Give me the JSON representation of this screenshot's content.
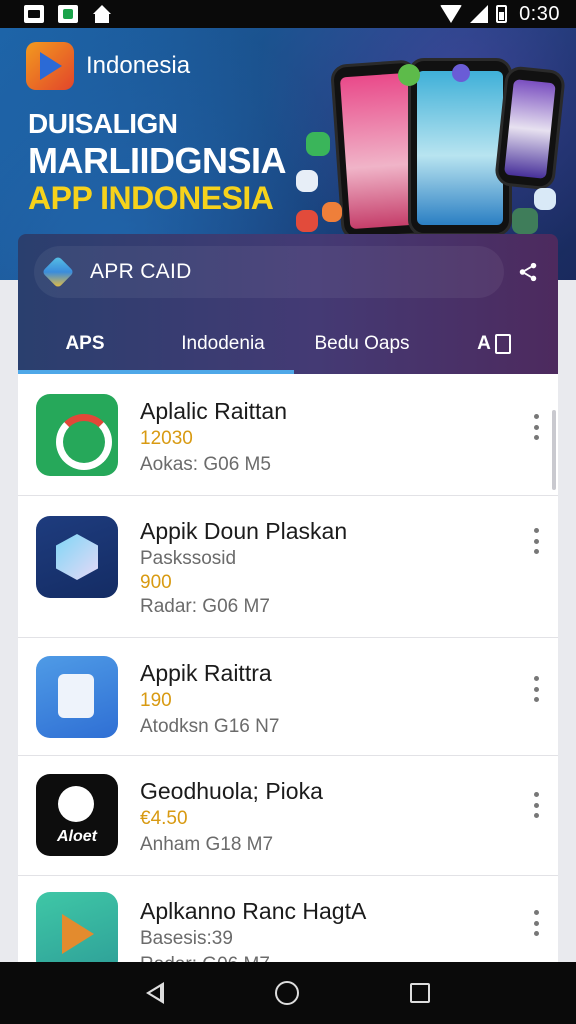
{
  "status_bar": {
    "time": "0:30"
  },
  "banner": {
    "brand": "Indonesia",
    "line1": "DUISALIGN",
    "line2": "MARLIIDGNSIA",
    "line3": "APP INDONESIA"
  },
  "search": {
    "text": "APR CAID"
  },
  "tabs": [
    {
      "label": "APS"
    },
    {
      "label": "Indodenia"
    },
    {
      "label": "Bedu Oaps"
    },
    {
      "label": "A"
    }
  ],
  "apps": [
    {
      "name": "Aplalic Raittan",
      "gold": "12030",
      "line_a": "",
      "line_b": "Aokas: G06 M5"
    },
    {
      "name": "Appik Doun Plaskan",
      "line_a": "Paskssosid",
      "gold": "900",
      "line_b": "Radar: G06 M7"
    },
    {
      "name": "Appik Raittra",
      "gold": "190",
      "line_a": "",
      "line_b": "Atodksn G16 N7"
    },
    {
      "name": "Geodhuola; Pioka",
      "gold": "€4.50",
      "line_a": "",
      "line_b": "Anham G18 M7",
      "icon_text": "Aloet"
    },
    {
      "name": "Aplkanno Ranc HagtA",
      "line_a": "Basesis:39",
      "gold": "",
      "line_b": "Radar: G06 M7"
    }
  ],
  "colors": {
    "accent": "#4fa8e8",
    "rating_gold": "#d89a12"
  }
}
